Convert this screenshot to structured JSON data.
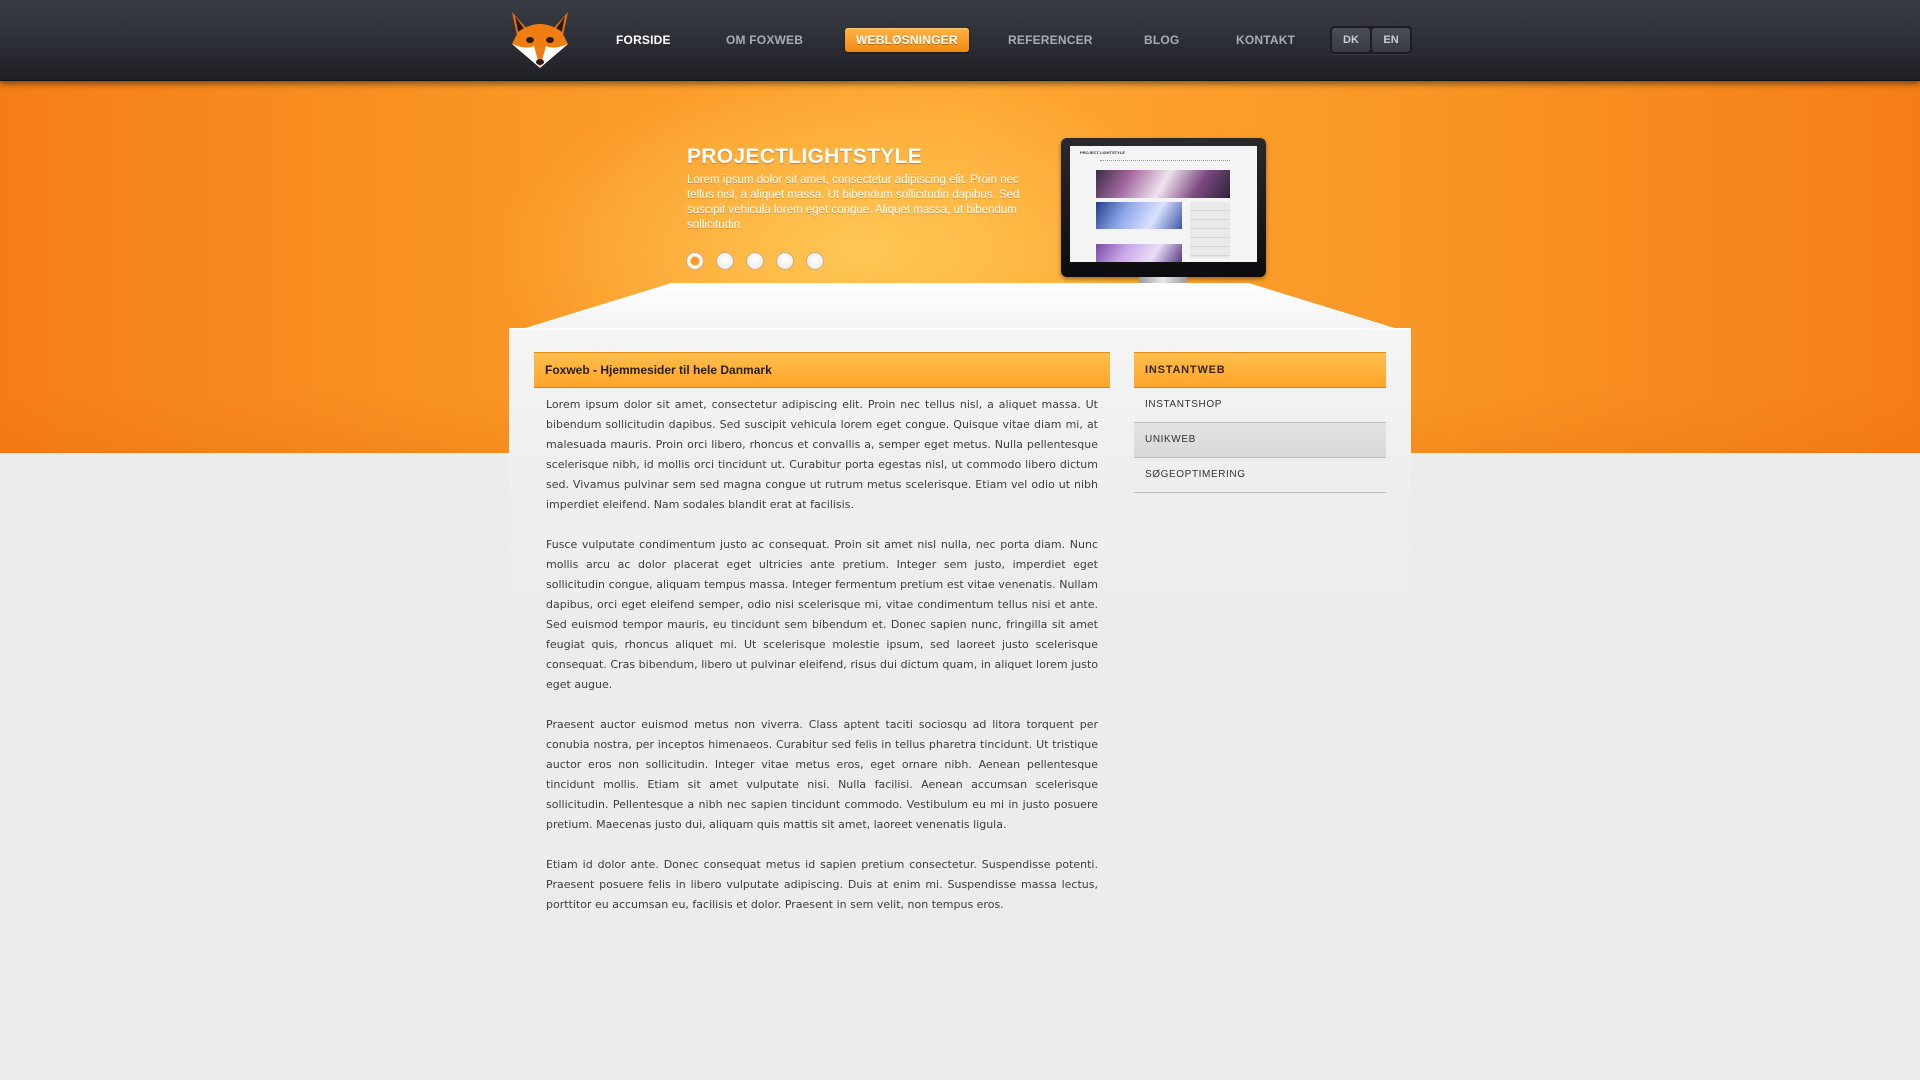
{
  "nav": {
    "items": [
      {
        "label": "FORSIDE"
      },
      {
        "label": "OM FOXWEB"
      },
      {
        "label": "WEBLØSNINGER"
      },
      {
        "label": "REFERENCER"
      },
      {
        "label": "BLOG"
      },
      {
        "label": "KONTAKT"
      }
    ],
    "active_index": 2,
    "languages": [
      "DK",
      "EN"
    ]
  },
  "logo": {
    "icon": "fox-head-icon"
  },
  "hero": {
    "title": "PROJECTLIGHTSTYLE",
    "text": "Lorem ipsum dolor sit amet, consectetur adipiscing elit. Proin nec tellus nisl, a aliquet massa. Ut bibendum sollicitudin dapibus. Sed suscipit vehicula lorem eget congue. Aliquet massa, ut bibendum sollicitudin.",
    "slides_count": 5,
    "active_slide": 0,
    "screen_title": "PROJECT LIGHTSTYLE"
  },
  "main": {
    "heading": "Foxweb - Hjemmesider til hele Danmark",
    "paragraphs": [
      "Lorem ipsum dolor sit amet, consectetur adipiscing elit. Proin nec tellus nisl, a aliquet massa. Ut bibendum sollicitudin dapibus. Sed suscipit vehicula lorem eget congue. Quisque vitae diam mi, at malesuada mauris. Proin orci libero, rhoncus et convallis a, semper eget metus. Nulla pellentesque scelerisque nibh, id mollis orci tincidunt ut. Curabitur porta egestas nisl, ut commodo libero dictum sed. Vivamus pulvinar sem sed magna congue ut rutrum metus scelerisque. Etiam vel odio ut nibh imperdiet eleifend. Nam sodales blandit erat at facilisis.",
      "Fusce vulputate condimentum justo ac consequat. Proin sit amet nisl nulla, nec porta diam. Nunc mollis arcu ac dolor placerat eget ultricies ante pretium. Integer sem justo, imperdiet eget sollicitudin congue, aliquam tempus massa. Integer fermentum pretium est vitae venenatis. Nullam dapibus, orci eget eleifend semper, odio nisi scelerisque mi, vitae condimentum tellus nisi et ante. Sed euismod tempor mauris, eu tincidunt sem bibendum et. Donec sapien nunc, fringilla sit amet feugiat quis, rhoncus aliquet mi. Ut scelerisque molestie ipsum, sed laoreet justo scelerisque consequat. Cras bibendum, libero ut pulvinar eleifend, risus dui dictum quam, in aliquet lorem justo eget augue.",
      "Praesent auctor euismod metus non viverra. Class aptent taciti sociosqu ad litora torquent per conubia nostra, per inceptos himenaeos. Curabitur sed felis in tellus pharetra tincidunt. Ut tristique auctor eros non sollicitudin. Integer vitae metus eros, eget ornare nibh. Aenean pellentesque tincidunt mollis. Etiam sit amet vulputate nisi. Nulla facilisi. Aenean accumsan scelerisque sollicitudin. Pellentesque a nibh nec sapien tincidunt commodo. Vestibulum eu mi in justo posuere pretium. Maecenas justo dui, aliquam quis mattis sit amet, laoreet venenatis ligula.",
      "Etiam id dolor ante. Donec consequat metus id sapien pretium consectetur. Suspendisse potenti. Praesent posuere felis in libero vulputate adipiscing. Duis at enim mi. Suspendisse massa lectus, porttitor eu accumsan eu, facilisis et dolor. Praesent in sem velit, non tempus eros."
    ]
  },
  "sidebar": {
    "heading": "INSTANTWEB",
    "items": [
      {
        "label": "INSTANTSHOP"
      },
      {
        "label": "UNIKWEB"
      },
      {
        "label": "SØGEOPTIMERING"
      }
    ]
  },
  "colors": {
    "accent": "#ffa42a",
    "nav_bg": "#2c2e35",
    "page_bg": "#ececec"
  }
}
